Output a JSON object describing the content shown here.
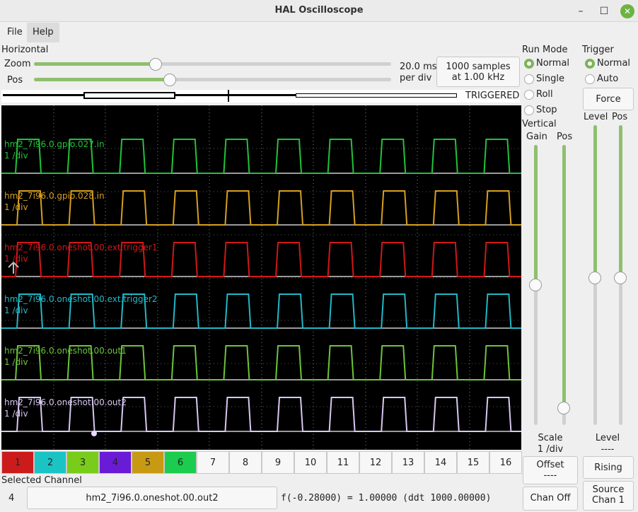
{
  "window": {
    "title": "HAL Oscilloscope",
    "min": "–",
    "max": "☐",
    "close": "✕"
  },
  "menu": [
    "File",
    "Help"
  ],
  "horizontal": {
    "title": "Horizontal",
    "zoom_label": "Zoom",
    "pos_label": "Pos",
    "zoom_level": 0.34,
    "pos_level": 0.38,
    "rate_line1": "20.0 ms",
    "rate_line2": "per div",
    "samples_line1": "1000 samples",
    "samples_line2": "at 1.00 kHz",
    "status": "TRIGGERED"
  },
  "runmode": {
    "title": "Run Mode",
    "options": [
      "Normal",
      "Single",
      "Roll",
      "Stop"
    ],
    "selected": "Normal"
  },
  "trigger": {
    "title": "Trigger",
    "options": [
      "Normal",
      "Auto"
    ],
    "selected": "Normal",
    "force": "Force",
    "level_label": "Level",
    "pos_label": "Pos",
    "level_value_label": "Level",
    "level_value": "----",
    "edge": "Rising",
    "source_line1": "Source",
    "source_line2": "Chan  1",
    "level_level": 0.49,
    "pos_level": 0.49
  },
  "vertical": {
    "title": "Vertical",
    "gain_label": "Gain",
    "pos_label": "Pos",
    "scale_label": "Scale",
    "scale_value": "1 /div",
    "offset_label": "Offset",
    "offset_value": "----",
    "chan_off": "Chan Off",
    "gain_level": 0.5,
    "pos_level": 0.06
  },
  "traces": [
    {
      "name": "hm2_7i96.0.gpio.027.in",
      "scale": "1 /div",
      "color": "#22c23a"
    },
    {
      "name": "hm2_7i96.0.gpio.028.in",
      "scale": "1 /div",
      "color": "#d6a020"
    },
    {
      "name": "hm2_7i96.0.oneshot.00.ext.trigger1",
      "scale": "1 /div",
      "color": "#d01818"
    },
    {
      "name": "hm2_7i96.0.oneshot.00.ext.trigger2",
      "scale": "1 /div",
      "color": "#22b8c8"
    },
    {
      "name": "hm2_7i96.0.oneshot.00.out1",
      "scale": "1 /div",
      "color": "#6cc43a"
    },
    {
      "name": "hm2_7i96.0.oneshot.00.out2",
      "scale": "1 /div",
      "color": "#d8c8f0"
    }
  ],
  "channels": [
    {
      "label": "1",
      "color": "#cc1b1b"
    },
    {
      "label": "2",
      "color": "#1bc4c4"
    },
    {
      "label": "3",
      "color": "#7acc1b"
    },
    {
      "label": "4",
      "color": "#6a1bd6"
    },
    {
      "label": "5",
      "color": "#c89a14"
    },
    {
      "label": "6",
      "color": "#1bcc4e"
    },
    {
      "label": "7",
      "color": ""
    },
    {
      "label": "8",
      "color": ""
    },
    {
      "label": "9",
      "color": ""
    },
    {
      "label": "10",
      "color": ""
    },
    {
      "label": "11",
      "color": ""
    },
    {
      "label": "12",
      "color": ""
    },
    {
      "label": "13",
      "color": ""
    },
    {
      "label": "14",
      "color": ""
    },
    {
      "label": "15",
      "color": ""
    },
    {
      "label": "16",
      "color": ""
    }
  ],
  "selected": {
    "title": "Selected Channel",
    "number": "4",
    "name": "hm2_7i96.0.oneshot.00.out2",
    "readout": "f(-0.28000) =  1.00000 (ddt  1000.00000)"
  }
}
